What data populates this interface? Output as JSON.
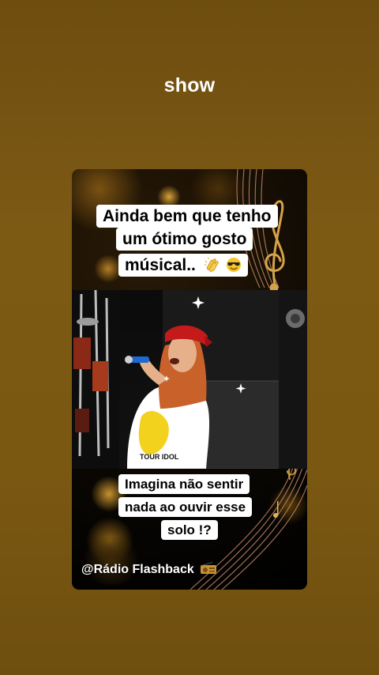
{
  "story": {
    "caption": "show"
  },
  "post": {
    "top_text_lines": [
      "Ainda bem que tenho",
      "um ótimo gosto",
      "músical.."
    ],
    "bottom_text_lines": [
      "Imagina não sentir",
      "nada ao ouvir esse",
      "solo !?"
    ],
    "watermark": "@Rádio Flashback",
    "shirt_text": "TOUR IDOL",
    "icons": [
      "clapping-hands-emoji",
      "sunglasses-smiley-emoji",
      "treble-clef-icon",
      "radio-icon"
    ]
  },
  "colors": {
    "background": "#7a5812",
    "bubble_bg": "#ffffff",
    "text": "#000000",
    "bandana": "#c41a1a",
    "hair": "#c8612a"
  }
}
